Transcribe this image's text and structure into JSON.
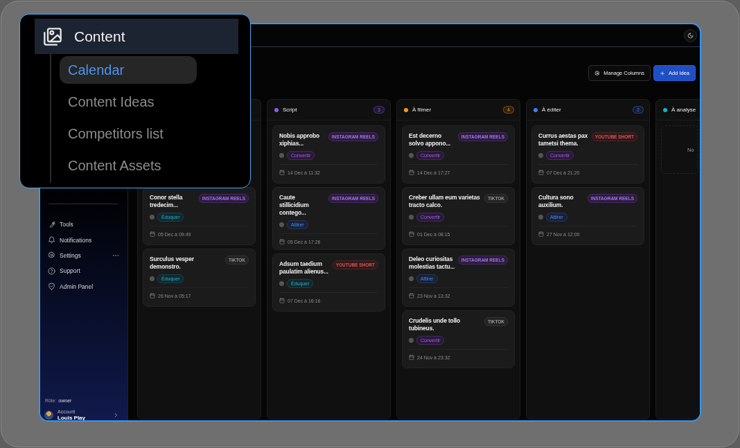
{
  "overlay": {
    "title": "Content",
    "items": [
      {
        "label": "Calendar",
        "selected": true
      },
      {
        "label": "Content Ideas",
        "selected": false
      },
      {
        "label": "Competitors list",
        "selected": false
      },
      {
        "label": "Content Assets",
        "selected": false
      }
    ]
  },
  "sidebar": {
    "items": [
      {
        "label": "Tools",
        "more": false
      },
      {
        "label": "Notifications",
        "more": false
      },
      {
        "label": "Settings",
        "more": true
      },
      {
        "label": "Support",
        "more": false
      },
      {
        "label": "Admin Panel",
        "more": false
      }
    ],
    "role_label": "Rôle:",
    "role": "owner",
    "account": {
      "label": "Account",
      "name": "Louis Play"
    }
  },
  "header": {
    "buttons": [
      {
        "label": "Manage Columns",
        "kind": "secondary"
      },
      {
        "label": "Add Idea",
        "kind": "primary"
      }
    ]
  },
  "columns": [
    {
      "cards": [
        {
          "title": "Conor stella tredecim...",
          "platform": {
            "label": "INSTAGRAM REELS",
            "kind": "instagram"
          },
          "category": {
            "label": "Éduquer",
            "kind": "educate"
          },
          "date": "05 Dec à 09:49"
        },
        {
          "title": "Surculus vesper demonstro.",
          "platform": {
            "label": "TIKTOK",
            "kind": "tiktok"
          },
          "category": {
            "label": "Éduquer",
            "kind": "educate"
          },
          "date": "26 Nov à 05:17"
        }
      ]
    },
    {
      "title": "Script",
      "color": "#8b5cf6",
      "count": "3",
      "cards": [
        {
          "title": "Nobis approbo xiphias...",
          "platform": {
            "label": "INSTAGRAM REELS",
            "kind": "instagram"
          },
          "category": {
            "label": "Convertir",
            "kind": "convert"
          },
          "date": "14 Dec à 11:32"
        },
        {
          "title": "Caute stillicidium contego...",
          "platform": {
            "label": "INSTAGRAM REELS",
            "kind": "instagram"
          },
          "category": {
            "label": "Attirer",
            "kind": "attract"
          },
          "date": "05 Dec à 17:26"
        },
        {
          "title": "Adsum taedium paulatim alienus...",
          "platform": {
            "label": "YOUTUBE SHORT",
            "kind": "youtube"
          },
          "category": {
            "label": "Éduquer",
            "kind": "educate"
          },
          "date": "07 Dec à 16:16"
        }
      ]
    },
    {
      "title": "À filmer",
      "color": "#f59e0b",
      "count": "4",
      "cards": [
        {
          "title": "Est decerno solvo appono...",
          "platform": {
            "label": "INSTAGRAM REELS",
            "kind": "instagram"
          },
          "category": {
            "label": "Convertir",
            "kind": "convert"
          },
          "date": "14 Dec à 17:27"
        },
        {
          "title": "Creber ullam eum varietas tracto calco.",
          "platform": {
            "label": "TIKTOK",
            "kind": "tiktok"
          },
          "category": {
            "label": "Convertir",
            "kind": "convert"
          },
          "date": "01 Dec à 08:15"
        },
        {
          "title": "Deleo curiositas molestias tactu...",
          "platform": {
            "label": "INSTAGRAM REELS",
            "kind": "instagram"
          },
          "category": {
            "label": "Attirer",
            "kind": "attract"
          },
          "date": "23 Nov à 13:32"
        },
        {
          "title": "Crudelis unde tollo tubineus.",
          "platform": {
            "label": "TIKTOK",
            "kind": "tiktok"
          },
          "category": {
            "label": "Convertir",
            "kind": "convert"
          },
          "date": "24 Nov à 23:32"
        }
      ]
    },
    {
      "title": "À éditer",
      "color": "#3b82f6",
      "count": "2",
      "cards": [
        {
          "title": "Currus aestas pax tametsi thema.",
          "platform": {
            "label": "YOUTUBE SHORT",
            "kind": "youtube"
          },
          "category": {
            "label": "Convertir",
            "kind": "convert"
          },
          "date": "07 Dec à 21:20"
        },
        {
          "title": "Cultura sono auxilium.",
          "platform": {
            "label": "INSTAGRAM REELS",
            "kind": "instagram"
          },
          "category": {
            "label": "Attirer",
            "kind": "attract"
          },
          "date": "27 Nov à 12:00"
        }
      ]
    },
    {
      "title": "À analyse",
      "color": "#06b6d4",
      "empty_text": "No"
    }
  ]
}
